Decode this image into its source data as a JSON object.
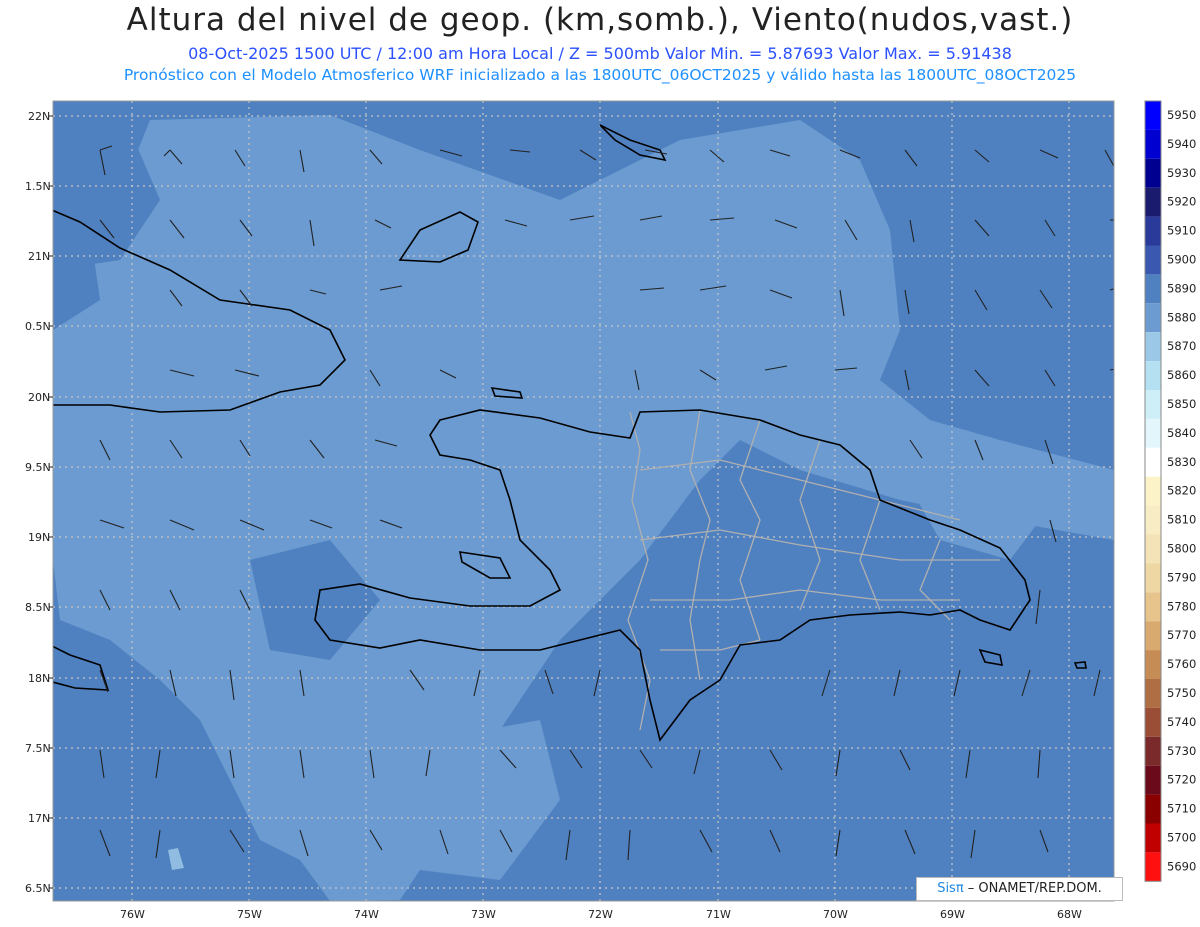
{
  "header": {
    "title": "Altura del nivel de geop. (km,somb.), Viento(nudos,vast.)",
    "line1": "08-Oct-2025  1500 UTC / 12:00 am Hora Local / Z = 500mb    Valor Min. = 5.87693  Valor Max. = 5.91438",
    "line2": "Pronóstico con el Modelo Atmosferico WRF inicializado a las 1800UTC_06OCT2025 y válido hasta las  1800UTC_08OCT2025"
  },
  "map": {
    "lat_labels": [
      "22N",
      "1.5N",
      "21N",
      "0.5N",
      "20N",
      "9.5N",
      "19N",
      "8.5N",
      "18N",
      "7.5N",
      "17N",
      "6.5N"
    ],
    "lon_labels": [
      "76W",
      "75W",
      "74W",
      "73W",
      "72W",
      "71W",
      "70W",
      "69W",
      "68W"
    ],
    "fill_colors": {
      "dark": "#4f80c0",
      "light": "#6b9bd0",
      "lighter": "#8fbce0",
      "land_border": "#b0b0b0"
    }
  },
  "colorbar": {
    "labels": [
      "5950",
      "5940",
      "5930",
      "5920",
      "5910",
      "5900",
      "5890",
      "5880",
      "5870",
      "5860",
      "5850",
      "5840",
      "5830",
      "5820",
      "5810",
      "5800",
      "5790",
      "5780",
      "5770",
      "5760",
      "5750",
      "5740",
      "5730",
      "5720",
      "5710",
      "5700",
      "5690"
    ],
    "colors": [
      "#0000ff",
      "#0000d0",
      "#000090",
      "#1a1a6e",
      "#2a3a9a",
      "#3a58b0",
      "#4f80c0",
      "#6b9bd0",
      "#9ac8e6",
      "#b4e0f2",
      "#cfeff8",
      "#e2f6fb",
      "#ffffff",
      "#fdf3c9",
      "#f7ecc4",
      "#f3e3b6",
      "#eed7a2",
      "#e6c48c",
      "#d8aa70",
      "#c68c56",
      "#b06e44",
      "#9a4e36",
      "#7a2a2a",
      "#6a0a1a",
      "#8a0000",
      "#c00000",
      "#ff1010"
    ]
  },
  "credit": {
    "brand": "Sisπ",
    "text": " – ONAMET/REP.DOM."
  }
}
